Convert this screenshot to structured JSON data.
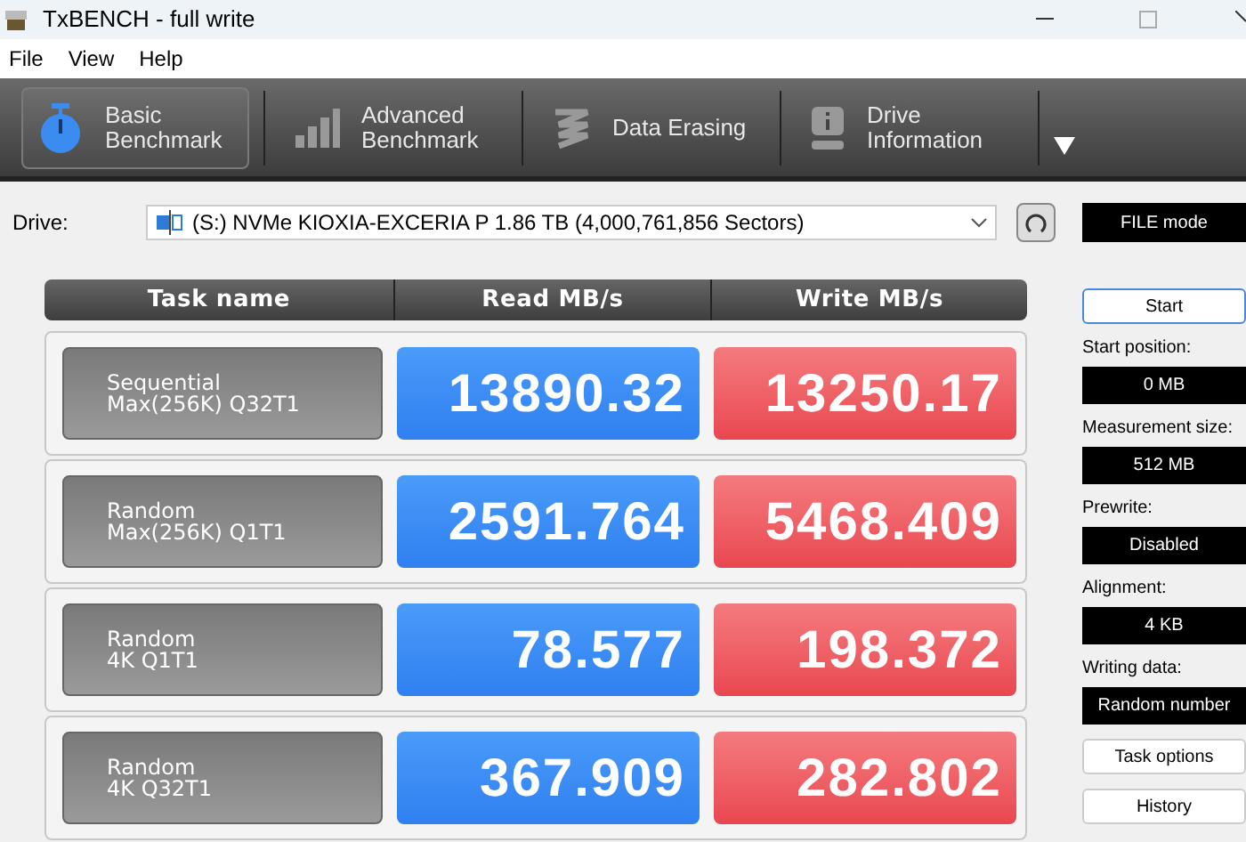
{
  "window": {
    "title": "TxBENCH - full write"
  },
  "menu": [
    "File",
    "View",
    "Help"
  ],
  "tabs": [
    {
      "label": "Basic\nBenchmark",
      "kind": "timer",
      "selected": true
    },
    {
      "label": "Advanced\nBenchmark",
      "kind": "bars",
      "selected": false
    },
    {
      "label": "Data Erasing",
      "kind": "erase",
      "selected": false
    },
    {
      "label": "Drive\nInformation",
      "kind": "info",
      "selected": false
    }
  ],
  "drive": {
    "label": "Drive:",
    "value": "(S:) NVMe KIOXIA-EXCERIA P  1.86 TB (4,000,761,856 Sectors)"
  },
  "mode": "FILE mode",
  "table": {
    "columns": [
      "Task name",
      "Read MB/s",
      "Write MB/s"
    ],
    "rows": [
      {
        "task": "Sequential\nMax(256K) Q32T1",
        "read": "13890.32",
        "write": "13250.17"
      },
      {
        "task": "Random\nMax(256K) Q1T1",
        "read": "2591.764",
        "write": "5468.409"
      },
      {
        "task": "Random\n4K Q1T1",
        "read": "78.577",
        "write": "198.372"
      },
      {
        "task": "Random\n4K Q32T1",
        "read": "367.909",
        "write": "282.802"
      }
    ]
  },
  "side": {
    "start": "Start",
    "settings": [
      {
        "label": "Start position:",
        "value": "0 MB"
      },
      {
        "label": "Measurement size:",
        "value": "512 MB"
      },
      {
        "label": "Prewrite:",
        "value": "Disabled"
      },
      {
        "label": "Alignment:",
        "value": "4 KB"
      },
      {
        "label": "Writing data:",
        "value": "Random number"
      }
    ],
    "buttons": [
      "Task options",
      "History"
    ]
  }
}
